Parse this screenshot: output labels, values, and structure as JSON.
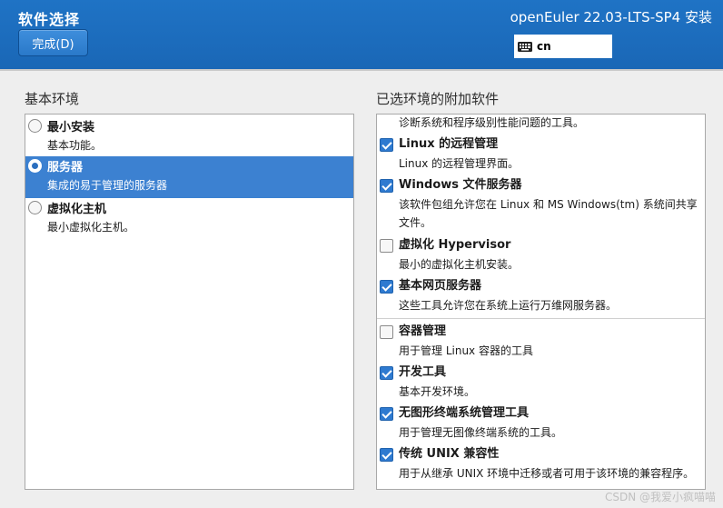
{
  "header": {
    "title": "软件选择",
    "done_label": "完成(D)",
    "product": "openEuler 22.03-LTS-SP4 安装",
    "keyboard_layout": "cn",
    "keyboard_icon": "keyboard-icon",
    "accent": "#1f73c5"
  },
  "base_env": {
    "heading": "基本环境",
    "items": [
      {
        "title": "最小安装",
        "desc": "基本功能。",
        "selected": false
      },
      {
        "title": "服务器",
        "desc": "集成的易于管理的服务器",
        "selected": true
      },
      {
        "title": "虚拟化主机",
        "desc": "最小虚拟化主机。",
        "selected": false
      }
    ]
  },
  "addons": {
    "heading": "已选环境的附加软件",
    "top_partial_desc": "诊断系统和程序级别性能问题的工具。",
    "items": [
      {
        "title": "Linux 的远程管理",
        "desc": "Linux 的远程管理界面。",
        "checked": true
      },
      {
        "title": "Windows 文件服务器",
        "desc": "该软件包组允许您在 Linux 和 MS Windows(tm) 系统间共享文件。",
        "checked": true
      },
      {
        "title": "虚拟化 Hypervisor",
        "desc": "最小的虚拟化主机安装。",
        "checked": false
      },
      {
        "title": "基本网页服务器",
        "desc": "这些工具允许您在系统上运行万维网服务器。",
        "checked": true
      },
      {
        "title": "容器管理",
        "desc": "用于管理 Linux 容器的工具",
        "checked": false
      },
      {
        "title": "开发工具",
        "desc": "基本开发环境。",
        "checked": true
      },
      {
        "title": "无图形终端系统管理工具",
        "desc": "用于管理无图像终端系统的工具。",
        "checked": true
      },
      {
        "title": "传统 UNIX 兼容性",
        "desc": "用于从继承 UNIX 环境中迁移或者可用于该环境的兼容程序。",
        "checked": true
      }
    ]
  },
  "watermark": "CSDN @我爱小疯喵喵"
}
